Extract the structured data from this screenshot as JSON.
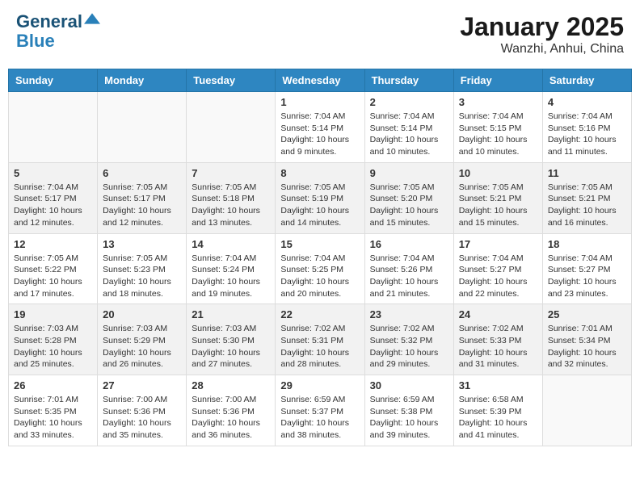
{
  "header": {
    "logo_line1": "General",
    "logo_line2": "Blue",
    "month": "January 2025",
    "location": "Wanzhi, Anhui, China"
  },
  "days_of_week": [
    "Sunday",
    "Monday",
    "Tuesday",
    "Wednesday",
    "Thursday",
    "Friday",
    "Saturday"
  ],
  "weeks": [
    [
      {
        "day": "",
        "info": ""
      },
      {
        "day": "",
        "info": ""
      },
      {
        "day": "",
        "info": ""
      },
      {
        "day": "1",
        "info": "Sunrise: 7:04 AM\nSunset: 5:14 PM\nDaylight: 10 hours\nand 9 minutes."
      },
      {
        "day": "2",
        "info": "Sunrise: 7:04 AM\nSunset: 5:14 PM\nDaylight: 10 hours\nand 10 minutes."
      },
      {
        "day": "3",
        "info": "Sunrise: 7:04 AM\nSunset: 5:15 PM\nDaylight: 10 hours\nand 10 minutes."
      },
      {
        "day": "4",
        "info": "Sunrise: 7:04 AM\nSunset: 5:16 PM\nDaylight: 10 hours\nand 11 minutes."
      }
    ],
    [
      {
        "day": "5",
        "info": "Sunrise: 7:04 AM\nSunset: 5:17 PM\nDaylight: 10 hours\nand 12 minutes."
      },
      {
        "day": "6",
        "info": "Sunrise: 7:05 AM\nSunset: 5:17 PM\nDaylight: 10 hours\nand 12 minutes."
      },
      {
        "day": "7",
        "info": "Sunrise: 7:05 AM\nSunset: 5:18 PM\nDaylight: 10 hours\nand 13 minutes."
      },
      {
        "day": "8",
        "info": "Sunrise: 7:05 AM\nSunset: 5:19 PM\nDaylight: 10 hours\nand 14 minutes."
      },
      {
        "day": "9",
        "info": "Sunrise: 7:05 AM\nSunset: 5:20 PM\nDaylight: 10 hours\nand 15 minutes."
      },
      {
        "day": "10",
        "info": "Sunrise: 7:05 AM\nSunset: 5:21 PM\nDaylight: 10 hours\nand 15 minutes."
      },
      {
        "day": "11",
        "info": "Sunrise: 7:05 AM\nSunset: 5:21 PM\nDaylight: 10 hours\nand 16 minutes."
      }
    ],
    [
      {
        "day": "12",
        "info": "Sunrise: 7:05 AM\nSunset: 5:22 PM\nDaylight: 10 hours\nand 17 minutes."
      },
      {
        "day": "13",
        "info": "Sunrise: 7:05 AM\nSunset: 5:23 PM\nDaylight: 10 hours\nand 18 minutes."
      },
      {
        "day": "14",
        "info": "Sunrise: 7:04 AM\nSunset: 5:24 PM\nDaylight: 10 hours\nand 19 minutes."
      },
      {
        "day": "15",
        "info": "Sunrise: 7:04 AM\nSunset: 5:25 PM\nDaylight: 10 hours\nand 20 minutes."
      },
      {
        "day": "16",
        "info": "Sunrise: 7:04 AM\nSunset: 5:26 PM\nDaylight: 10 hours\nand 21 minutes."
      },
      {
        "day": "17",
        "info": "Sunrise: 7:04 AM\nSunset: 5:27 PM\nDaylight: 10 hours\nand 22 minutes."
      },
      {
        "day": "18",
        "info": "Sunrise: 7:04 AM\nSunset: 5:27 PM\nDaylight: 10 hours\nand 23 minutes."
      }
    ],
    [
      {
        "day": "19",
        "info": "Sunrise: 7:03 AM\nSunset: 5:28 PM\nDaylight: 10 hours\nand 25 minutes."
      },
      {
        "day": "20",
        "info": "Sunrise: 7:03 AM\nSunset: 5:29 PM\nDaylight: 10 hours\nand 26 minutes."
      },
      {
        "day": "21",
        "info": "Sunrise: 7:03 AM\nSunset: 5:30 PM\nDaylight: 10 hours\nand 27 minutes."
      },
      {
        "day": "22",
        "info": "Sunrise: 7:02 AM\nSunset: 5:31 PM\nDaylight: 10 hours\nand 28 minutes."
      },
      {
        "day": "23",
        "info": "Sunrise: 7:02 AM\nSunset: 5:32 PM\nDaylight: 10 hours\nand 29 minutes."
      },
      {
        "day": "24",
        "info": "Sunrise: 7:02 AM\nSunset: 5:33 PM\nDaylight: 10 hours\nand 31 minutes."
      },
      {
        "day": "25",
        "info": "Sunrise: 7:01 AM\nSunset: 5:34 PM\nDaylight: 10 hours\nand 32 minutes."
      }
    ],
    [
      {
        "day": "26",
        "info": "Sunrise: 7:01 AM\nSunset: 5:35 PM\nDaylight: 10 hours\nand 33 minutes."
      },
      {
        "day": "27",
        "info": "Sunrise: 7:00 AM\nSunset: 5:36 PM\nDaylight: 10 hours\nand 35 minutes."
      },
      {
        "day": "28",
        "info": "Sunrise: 7:00 AM\nSunset: 5:36 PM\nDaylight: 10 hours\nand 36 minutes."
      },
      {
        "day": "29",
        "info": "Sunrise: 6:59 AM\nSunset: 5:37 PM\nDaylight: 10 hours\nand 38 minutes."
      },
      {
        "day": "30",
        "info": "Sunrise: 6:59 AM\nSunset: 5:38 PM\nDaylight: 10 hours\nand 39 minutes."
      },
      {
        "day": "31",
        "info": "Sunrise: 6:58 AM\nSunset: 5:39 PM\nDaylight: 10 hours\nand 41 minutes."
      },
      {
        "day": "",
        "info": ""
      }
    ]
  ]
}
